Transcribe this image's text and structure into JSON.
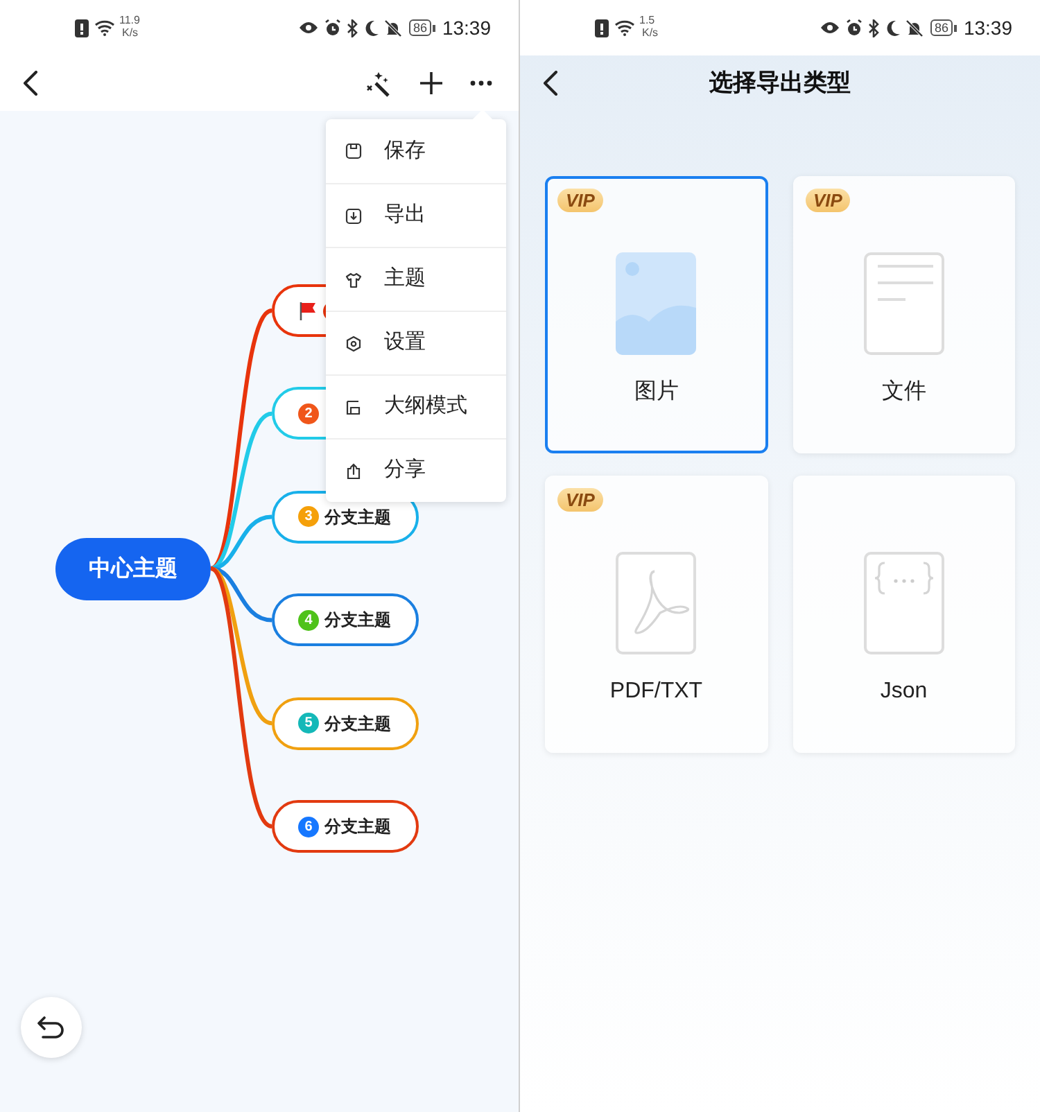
{
  "left_screen": {
    "status_bar": {
      "speed_value": "11.9",
      "speed_unit": "K/s",
      "battery": "86",
      "time": "13:39"
    },
    "mind_map": {
      "center": {
        "label": "中心主题"
      },
      "branches": [
        {
          "color": "#e8340c",
          "badge": {
            "color": "#e8340c"
          },
          "flagged": true
        },
        {
          "color": "#22cbe8",
          "badge": {
            "color": "#f0561a",
            "number": "2"
          },
          "flagged": false
        },
        {
          "color": "#18b0ea",
          "badge": {
            "color": "#f5a00a",
            "number": "3"
          },
          "label": "分支主题",
          "flagged": false
        },
        {
          "color": "#1a7fe0",
          "badge": {
            "color": "#4fc21a",
            "number": "4"
          },
          "label": "分支主题",
          "flagged": false
        },
        {
          "color": "#f0a010",
          "badge": {
            "color": "#14b8b8",
            "number": "5"
          },
          "label": "分支主题",
          "flagged": false
        },
        {
          "color": "#e23a10",
          "badge": {
            "color": "#1677ff",
            "number": "6"
          },
          "label": "分支主题",
          "flagged": false
        }
      ]
    },
    "menu": {
      "items": [
        {
          "kind": "save",
          "label": "保存"
        },
        {
          "kind": "export",
          "label": "导出"
        },
        {
          "kind": "theme",
          "label": "主题"
        },
        {
          "kind": "settings",
          "label": "设置"
        },
        {
          "kind": "outline",
          "label": "大纲模式"
        },
        {
          "kind": "share",
          "label": "分享"
        }
      ]
    }
  },
  "right_screen": {
    "status_bar": {
      "speed_value": "1.5",
      "speed_unit": "K/s",
      "battery": "86",
      "time": "13:39"
    },
    "header": {
      "title": "选择导出类型"
    },
    "export_options": [
      {
        "kind": "image",
        "label": "图片",
        "vip": "VIP",
        "selected": true
      },
      {
        "kind": "document",
        "label": "文件",
        "vip": "VIP",
        "selected": false
      },
      {
        "kind": "pdf",
        "label": "PDF/TXT",
        "vip": "VIP",
        "selected": false
      },
      {
        "kind": "json",
        "label": "Json",
        "selected": false
      }
    ]
  }
}
